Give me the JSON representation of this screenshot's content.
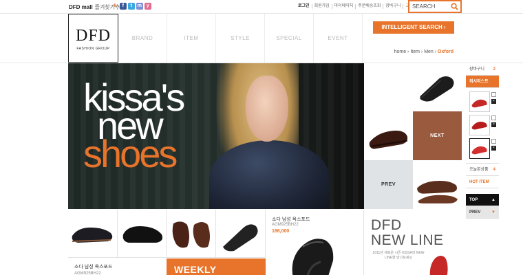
{
  "topbar": {
    "brand": "DFD mall",
    "favorite": "즐겨찾기추가",
    "links": [
      "로그인",
      "회원가입",
      "마이페이지",
      "주문배송조회",
      "장바구니",
      "고객센터"
    ],
    "search_placeholder": "SEARCH"
  },
  "logo": {
    "main": "DFD",
    "sub": "FASHION GROUP"
  },
  "nav": [
    "BRAND",
    "ITEM",
    "STYLE",
    "SPECIAL",
    "EVENT"
  ],
  "intelligent_search": "INTELLIGENT SEARCH",
  "breadcrumb": [
    "home",
    "Item",
    "Men",
    "Oxford"
  ],
  "hero": {
    "line1": "kissa's",
    "line2": "new",
    "line3": "shoes"
  },
  "carousel": {
    "next_label": "NEXT",
    "prev_label": "PREV"
  },
  "sidebar": {
    "cart_label": "장바구니",
    "cart_count": "2",
    "wishlist_label": "위시리스트",
    "viewed_label": "오늘본상품",
    "viewed_count": "4",
    "hot_label": "HOT ITEM",
    "top_label": "TOP",
    "prev_label": "PREV"
  },
  "product": {
    "name": "소다 남성 옥스포드",
    "code": "AGM925BH22",
    "price": "186,000"
  },
  "weekly": "WEEKLY",
  "newline": {
    "title1": "DFD",
    "title2": "NEW LINE",
    "desc": "2011년 새로운 시즌 KISSA의 NEW LINE을 만나보세요"
  },
  "colors": {
    "accent": "#e8742b",
    "dark": "#111111",
    "brown_tile": "#9a5a3e",
    "gray_tile": "#dfe3e6"
  }
}
